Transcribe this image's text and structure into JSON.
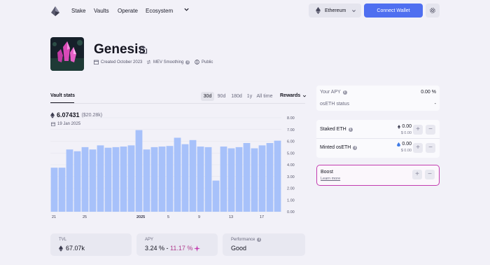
{
  "nav": {
    "items": [
      "Stake",
      "Vaults",
      "Operate",
      "Ecosystem"
    ],
    "network": "Ethereum",
    "connect_label": "Connect Wallet"
  },
  "vault": {
    "title": "Genesis",
    "created": "Created October 2023",
    "smoothing": "MEV Smoothing",
    "visibility": "Public"
  },
  "stats": {
    "tab_label": "Vault stats",
    "periods": [
      "30d",
      "90d",
      "180d",
      "1y",
      "All time"
    ],
    "active_period": "30d",
    "rewards_label": "Rewards",
    "eth_value": "6.07431",
    "usd_value": "($20.28k)",
    "date": "19 Jan 2025"
  },
  "chart_data": {
    "type": "bar",
    "values": [
      3.75,
      3.75,
      5.3,
      5.15,
      5.5,
      5.3,
      5.65,
      5.45,
      5.5,
      5.55,
      5.65,
      6.95,
      5.3,
      5.5,
      5.55,
      5.6,
      6.3,
      5.75,
      6.1,
      5.55,
      5.5,
      2.65,
      5.55,
      5.4,
      5.5,
      5.85,
      5.4,
      5.65,
      5.85,
      6.05
    ],
    "ylim": [
      0,
      8
    ],
    "yticks": [
      "0.00",
      "1.00",
      "2.00",
      "3.00",
      "4.00",
      "5.00",
      "6.00",
      "7.00",
      "8.00"
    ],
    "xticks": [
      {
        "index": 0,
        "label": "21"
      },
      {
        "index": 4,
        "label": "25"
      },
      {
        "index": 11,
        "label": "2025"
      },
      {
        "index": 15,
        "label": "5"
      },
      {
        "index": 19,
        "label": "9"
      },
      {
        "index": 23,
        "label": "13"
      },
      {
        "index": 27,
        "label": "17"
      }
    ],
    "bold_tick": "2025",
    "bar_color": "#a7c1fa"
  },
  "cards": {
    "tvl_label": "TVL",
    "tvl_value": "67.07k",
    "apy_label": "APY",
    "apy_base": "3.24 %",
    "apy_sep": " - ",
    "apy_range": "11.17 %",
    "performance_label": "Performance",
    "performance_value": "Good"
  },
  "panel": {
    "your_apy_label": "Your APY",
    "your_apy_value": "0.00 %",
    "oseth_status_label": "osETH status",
    "oseth_status_value": "-",
    "staked_label": "Staked ETH",
    "staked_value": "0.00",
    "staked_usd": "$ 0.00",
    "minted_label": "Minted osETH",
    "minted_value": "0.00",
    "minted_usd": "$ 0.00",
    "boost_label": "Boost",
    "boost_link": "Learn more",
    "plus": "+",
    "minus": "−"
  },
  "colors": {
    "accent": "#4f6ff0",
    "boost_border": "#c33cb0",
    "apy_range": "#b03e8e"
  }
}
